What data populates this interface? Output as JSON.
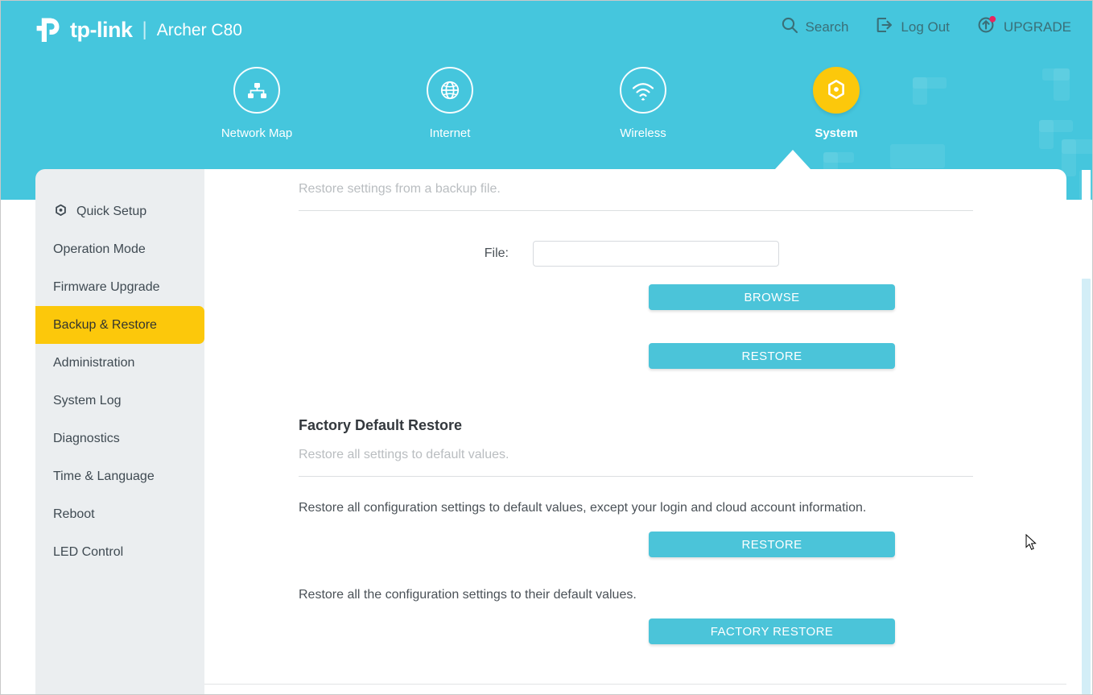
{
  "header": {
    "brand_name": "tp-link",
    "separator": "|",
    "model": "Archer C80",
    "actions": [
      {
        "label": "Search",
        "icon": "search-icon"
      },
      {
        "label": "Log Out",
        "icon": "logout-icon"
      },
      {
        "label": "UPGRADE",
        "icon": "upgrade-icon",
        "badge": true,
        "badge_color": "#e8265f"
      }
    ]
  },
  "nav": {
    "items": [
      {
        "label": "Network Map",
        "icon": "network-map-icon",
        "active": false
      },
      {
        "label": "Internet",
        "icon": "globe-icon",
        "active": false
      },
      {
        "label": "Wireless",
        "icon": "wifi-icon",
        "active": false
      },
      {
        "label": "System",
        "icon": "gear-icon",
        "active": true
      }
    ]
  },
  "sidebar": {
    "items": [
      {
        "label": "Quick Setup",
        "icon": "gear-icon",
        "active": false
      },
      {
        "label": "Operation Mode",
        "icon": null,
        "active": false
      },
      {
        "label": "Firmware Upgrade",
        "icon": null,
        "active": false
      },
      {
        "label": "Backup & Restore",
        "icon": null,
        "active": true
      },
      {
        "label": "Administration",
        "icon": null,
        "active": false
      },
      {
        "label": "System Log",
        "icon": null,
        "active": false
      },
      {
        "label": "Diagnostics",
        "icon": null,
        "active": false
      },
      {
        "label": "Time & Language",
        "icon": null,
        "active": false
      },
      {
        "label": "Reboot",
        "icon": null,
        "active": false
      },
      {
        "label": "LED Control",
        "icon": null,
        "active": false
      }
    ]
  },
  "main": {
    "restore_from_backup": {
      "subtitle": "Restore settings from a backup file.",
      "file_label": "File:",
      "file_value": "",
      "file_placeholder": "",
      "browse_button": "BROWSE",
      "restore_button": "RESTORE"
    },
    "factory_default_restore": {
      "title": "Factory Default Restore",
      "subtitle": "Restore all settings to default values.",
      "description_1": "Restore all configuration settings to default values, except your login and cloud account information.",
      "restore_button": "RESTORE",
      "description_2": "Restore all the configuration settings to their default values.",
      "factory_restore_button": "FACTORY RESTORE"
    }
  },
  "colors": {
    "brand_teal": "#45c6dd",
    "accent_yellow": "#fcc80b",
    "button_teal": "#4bc4d9",
    "sidebar_bg": "#ebeef0",
    "scrollbar_thumb": "#d3eef7",
    "header_action_text": "#3a6f78"
  }
}
